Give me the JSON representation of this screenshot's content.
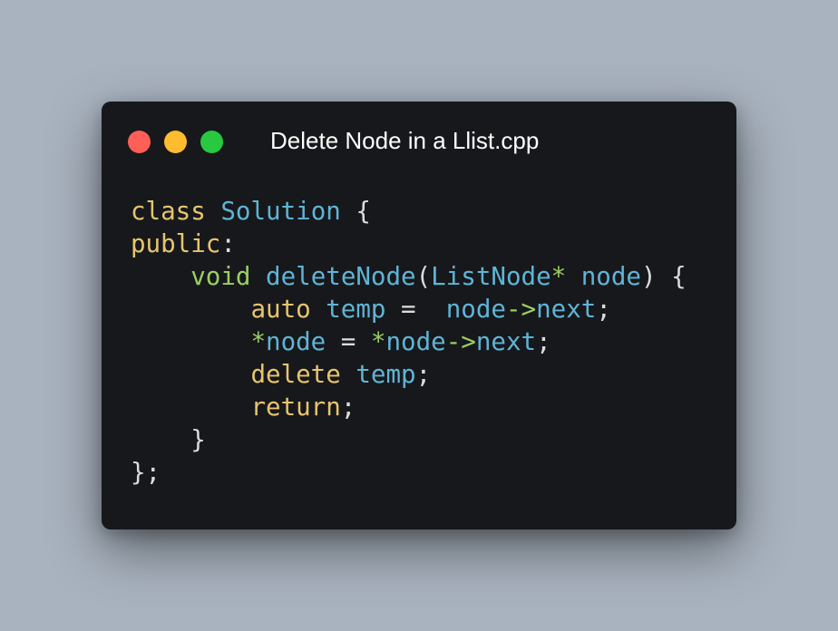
{
  "window": {
    "title": "Delete Node in a Llist.cpp",
    "buttons": {
      "close_color": "#ff5f57",
      "minimize_color": "#febc2e",
      "maximize_color": "#28c840"
    }
  },
  "theme": {
    "background": "#a9b3bf",
    "editor_background": "#17181b",
    "keyword_color": "#e6c56f",
    "type_color": "#5fb4d6",
    "operator_color": "#9ccf63",
    "plain_color": "#dcdcdc"
  },
  "code": {
    "language": "cpp",
    "lines": [
      [
        {
          "t": "class",
          "k": "kw"
        },
        {
          "t": " ",
          "k": "pn"
        },
        {
          "t": "Solution",
          "k": "ty"
        },
        {
          "t": " {",
          "k": "pn"
        }
      ],
      [
        {
          "t": "public",
          "k": "kw"
        },
        {
          "t": ":",
          "k": "pn"
        }
      ],
      [
        {
          "t": "    ",
          "k": "pn"
        },
        {
          "t": "void",
          "k": "op"
        },
        {
          "t": " ",
          "k": "pn"
        },
        {
          "t": "deleteNode",
          "k": "fn"
        },
        {
          "t": "(",
          "k": "pn"
        },
        {
          "t": "ListNode",
          "k": "ty"
        },
        {
          "t": "*",
          "k": "op"
        },
        {
          "t": " ",
          "k": "pn"
        },
        {
          "t": "node",
          "k": "ty"
        },
        {
          "t": ") {",
          "k": "pn"
        }
      ],
      [
        {
          "t": "        ",
          "k": "pn"
        },
        {
          "t": "auto",
          "k": "kw"
        },
        {
          "t": " ",
          "k": "pn"
        },
        {
          "t": "temp",
          "k": "ty"
        },
        {
          "t": " =  ",
          "k": "pn"
        },
        {
          "t": "node",
          "k": "ty"
        },
        {
          "t": "->",
          "k": "op"
        },
        {
          "t": "next",
          "k": "ty"
        },
        {
          "t": ";",
          "k": "pn"
        }
      ],
      [
        {
          "t": "        ",
          "k": "pn"
        },
        {
          "t": "*",
          "k": "op"
        },
        {
          "t": "node",
          "k": "ty"
        },
        {
          "t": " = ",
          "k": "pn"
        },
        {
          "t": "*",
          "k": "op"
        },
        {
          "t": "node",
          "k": "ty"
        },
        {
          "t": "->",
          "k": "op"
        },
        {
          "t": "next",
          "k": "ty"
        },
        {
          "t": ";",
          "k": "pn"
        }
      ],
      [
        {
          "t": "        ",
          "k": "pn"
        },
        {
          "t": "delete",
          "k": "kw"
        },
        {
          "t": " ",
          "k": "pn"
        },
        {
          "t": "temp",
          "k": "ty"
        },
        {
          "t": ";",
          "k": "pn"
        }
      ],
      [
        {
          "t": "        ",
          "k": "pn"
        },
        {
          "t": "return",
          "k": "kw"
        },
        {
          "t": ";",
          "k": "pn"
        }
      ],
      [
        {
          "t": "    }",
          "k": "pn"
        }
      ],
      [
        {
          "t": "};",
          "k": "pn"
        }
      ]
    ]
  }
}
